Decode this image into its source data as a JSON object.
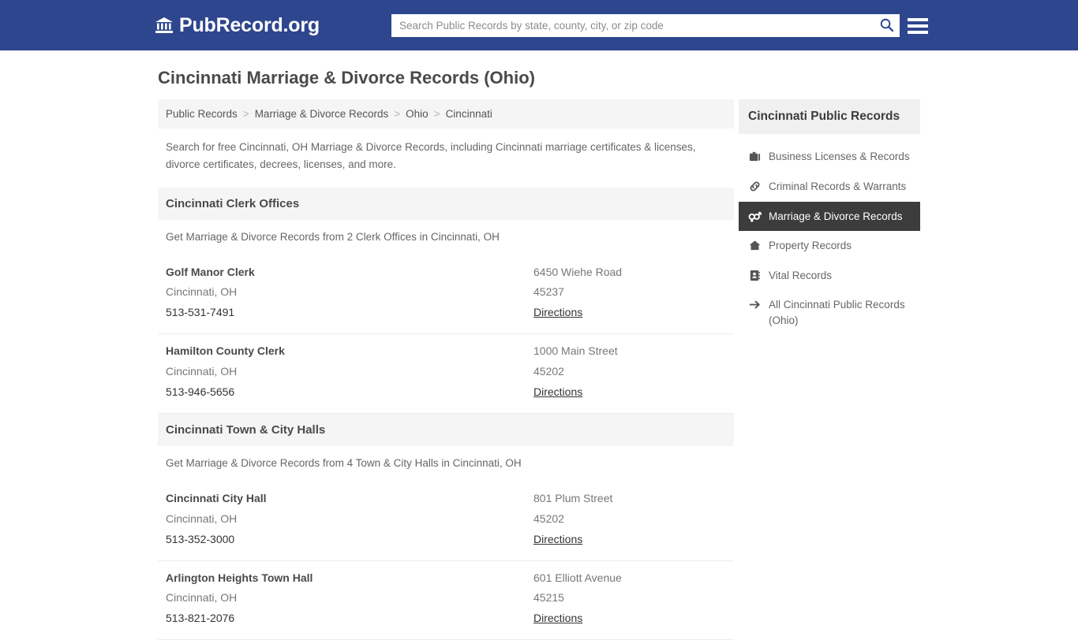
{
  "header": {
    "logo_icon": "bank-building-icon",
    "logo_text": "PubRecord.org",
    "search_placeholder": "Search Public Records by state, county, city, or zip code",
    "search_value": "",
    "search_icon": "search-icon",
    "menu_icon": "hamburger-menu-icon",
    "background_color": "#2e468e"
  },
  "page": {
    "title": "Cincinnati Marriage & Divorce Records (Ohio)",
    "intro": "Search for free Cincinnati, OH Marriage & Divorce Records, including Cincinnati marriage certificates & licenses, divorce certificates, decrees, licenses, and more."
  },
  "breadcrumb": {
    "separator": ">",
    "items": [
      {
        "label": "Public Records"
      },
      {
        "label": "Marriage & Divorce Records"
      },
      {
        "label": "Ohio"
      },
      {
        "label": "Cincinnati"
      }
    ]
  },
  "sections": [
    {
      "heading": "Cincinnati Clerk Offices",
      "subheading": "Get Marriage & Divorce Records from 2 Clerk Offices in Cincinnati, OH",
      "listings": [
        {
          "name": "Golf Manor Clerk",
          "city_state": "Cincinnati, OH",
          "phone": "513-531-7491",
          "street": "6450 Wiehe Road",
          "zip": "45237",
          "directions_label": "Directions"
        },
        {
          "name": "Hamilton County Clerk",
          "city_state": "Cincinnati, OH",
          "phone": "513-946-5656",
          "street": "1000 Main Street",
          "zip": "45202",
          "directions_label": "Directions"
        }
      ]
    },
    {
      "heading": "Cincinnati Town & City Halls",
      "subheading": "Get Marriage & Divorce Records from 4 Town & City Halls in Cincinnati, OH",
      "listings": [
        {
          "name": "Cincinnati City Hall",
          "city_state": "Cincinnati, OH",
          "phone": "513-352-3000",
          "street": "801 Plum Street",
          "zip": "45202",
          "directions_label": "Directions"
        },
        {
          "name": "Arlington Heights Town Hall",
          "city_state": "Cincinnati, OH",
          "phone": "513-821-2076",
          "street": "601 Elliott Avenue",
          "zip": "45215",
          "directions_label": "Directions"
        }
      ]
    }
  ],
  "sidebar": {
    "heading": "Cincinnati Public Records",
    "active_background": "#3c3c3c",
    "items": [
      {
        "label": "Business Licenses & Records",
        "icon": "briefcase-icon",
        "active": false
      },
      {
        "label": "Criminal Records & Warrants",
        "icon": "chain-link-icon",
        "active": false
      },
      {
        "label": "Marriage & Divorce Records",
        "icon": "venus-mars-icon",
        "active": true
      },
      {
        "label": "Property Records",
        "icon": "home-icon",
        "active": false
      },
      {
        "label": "Vital Records",
        "icon": "contact-card-icon",
        "active": false
      },
      {
        "label": "All Cincinnati Public Records (Ohio)",
        "icon": "arrow-right-icon",
        "active": false
      }
    ]
  }
}
